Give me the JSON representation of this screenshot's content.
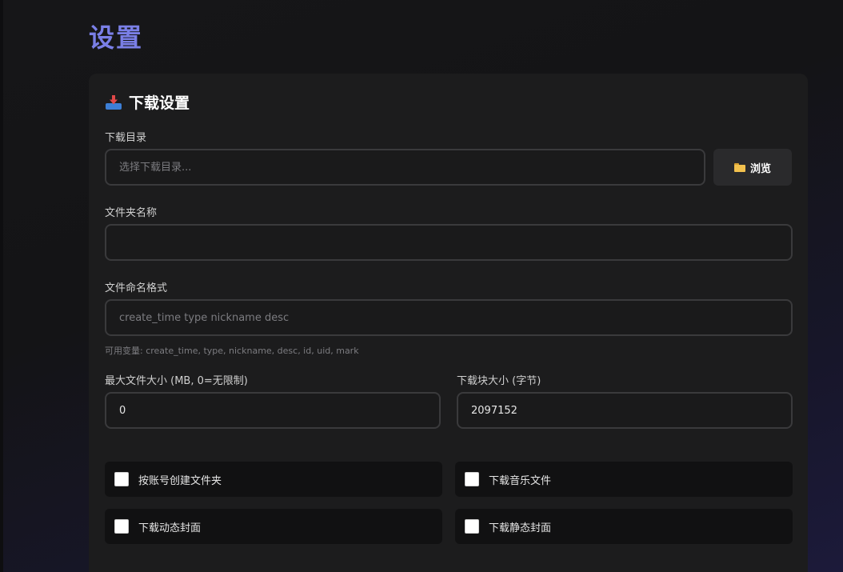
{
  "page": {
    "title": "设置"
  },
  "download_settings": {
    "section_title": "下载设置",
    "section_icon": "download-tray-icon",
    "download_dir": {
      "label": "下载目录",
      "value": "",
      "placeholder": "选择下载目录..."
    },
    "browse_button": {
      "label": "浏览",
      "icon": "folder-icon"
    },
    "folder_name": {
      "label": "文件夹名称",
      "value": "",
      "placeholder": ""
    },
    "naming_format": {
      "label": "文件命名格式",
      "value": "",
      "placeholder": "create_time type nickname desc",
      "hint": "可用变量: create_time, type, nickname, desc, id, uid, mark"
    },
    "max_file_size": {
      "label": "最大文件大小 (MB, 0=无限制)",
      "value": "0"
    },
    "chunk_size": {
      "label": "下载块大小 (字节)",
      "value": "2097152"
    },
    "options": [
      {
        "label": "按账号创建文件夹",
        "checked": false
      },
      {
        "label": "下载音乐文件",
        "checked": false
      },
      {
        "label": "下载动态封面",
        "checked": false
      },
      {
        "label": "下载静态封面",
        "checked": false
      }
    ]
  },
  "colors": {
    "accent": "#7a7fe6",
    "card_bg": "#1c1c1d",
    "input_border": "#3a3a3c"
  }
}
